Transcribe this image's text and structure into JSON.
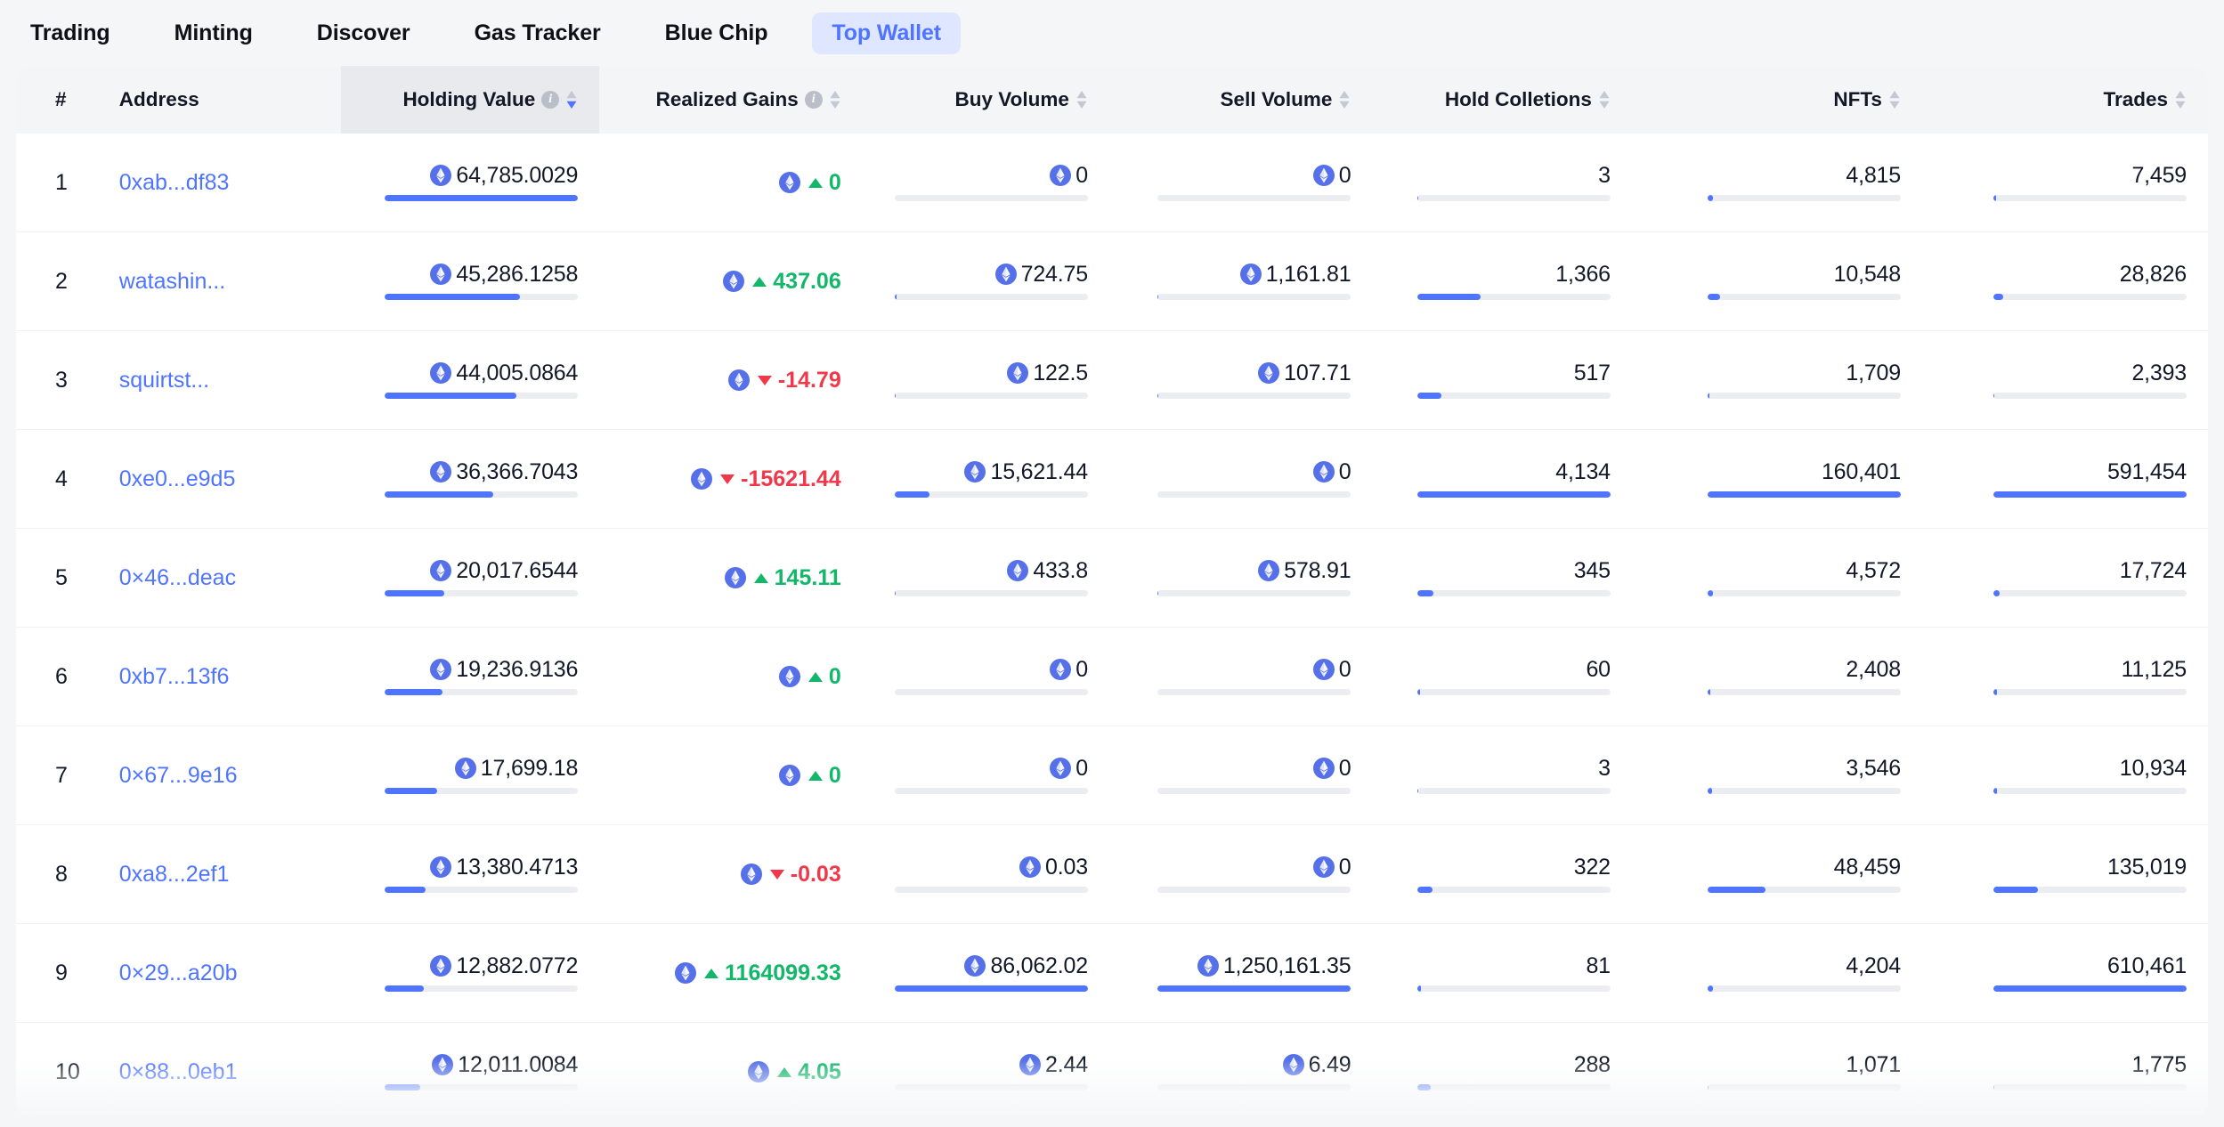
{
  "nav": {
    "items": [
      {
        "label": "Trading",
        "active": false
      },
      {
        "label": "Minting",
        "active": false
      },
      {
        "label": "Discover",
        "active": false
      },
      {
        "label": "Gas Tracker",
        "active": false
      },
      {
        "label": "Blue Chip",
        "active": false
      },
      {
        "label": "Top Wallet",
        "active": true
      }
    ]
  },
  "table": {
    "columns": [
      {
        "key": "rank",
        "label": "#",
        "align": "left",
        "info": false,
        "sort": "none"
      },
      {
        "key": "addr",
        "label": "Address",
        "align": "left",
        "info": false,
        "sort": "none"
      },
      {
        "key": "hold",
        "label": "Holding Value",
        "align": "right",
        "info": true,
        "sort": "desc"
      },
      {
        "key": "gains",
        "label": "Realized Gains",
        "align": "right",
        "info": true,
        "sort": "none"
      },
      {
        "key": "buy",
        "label": "Buy Volume",
        "align": "right",
        "info": false,
        "sort": "none"
      },
      {
        "key": "sell",
        "label": "Sell Volume",
        "align": "right",
        "info": false,
        "sort": "none"
      },
      {
        "key": "coll",
        "label": "Hold Colletions",
        "align": "right",
        "info": false,
        "sort": "none"
      },
      {
        "key": "nfts",
        "label": "NFTs",
        "align": "right",
        "info": false,
        "sort": "none"
      },
      {
        "key": "trades",
        "label": "Trades",
        "align": "right",
        "info": false,
        "sort": "none"
      }
    ],
    "rows": [
      {
        "rank": "1",
        "address": "0xab...df83",
        "holding_value": "64,785.0029",
        "holding_pct": 100,
        "realized_gains": "0",
        "gains_dir": "up",
        "buy_volume": "0",
        "buy_pct": 0,
        "sell_volume": "0",
        "sell_pct": 0,
        "hold_collections": "3",
        "coll_pct": 0.1,
        "nfts": "4,815",
        "nfts_pct": 3,
        "trades": "7,459",
        "trades_pct": 1.3
      },
      {
        "rank": "2",
        "address": "watashin...",
        "holding_value": "45,286.1258",
        "holding_pct": 70,
        "realized_gains": "437.06",
        "gains_dir": "up",
        "buy_volume": "724.75",
        "buy_pct": 0.9,
        "sell_volume": "1,161.81",
        "sell_pct": 0.1,
        "hold_collections": "1,366",
        "coll_pct": 33,
        "nfts": "10,548",
        "nfts_pct": 6.5,
        "trades": "28,826",
        "trades_pct": 4.9
      },
      {
        "rank": "3",
        "address": "squirtst...",
        "holding_value": "44,005.0864",
        "holding_pct": 68,
        "realized_gains": "-14.79",
        "gains_dir": "down",
        "buy_volume": "122.5",
        "buy_pct": 0.2,
        "sell_volume": "107.71",
        "sell_pct": 0.1,
        "hold_collections": "517",
        "coll_pct": 12.5,
        "nfts": "1,709",
        "nfts_pct": 1.1,
        "trades": "2,393",
        "trades_pct": 0.4
      },
      {
        "rank": "4",
        "address": "0xe0...e9d5",
        "holding_value": "36,366.7043",
        "holding_pct": 56,
        "realized_gains": "-15621.44",
        "gains_dir": "down",
        "buy_volume": "15,621.44",
        "buy_pct": 18,
        "sell_volume": "0",
        "sell_pct": 0,
        "hold_collections": "4,134",
        "coll_pct": 100,
        "nfts": "160,401",
        "nfts_pct": 100,
        "trades": "591,454",
        "trades_pct": 100
      },
      {
        "rank": "5",
        "address": "0×46...deac",
        "holding_value": "20,017.6544",
        "holding_pct": 31,
        "realized_gains": "145.11",
        "gains_dir": "up",
        "buy_volume": "433.8",
        "buy_pct": 0.5,
        "sell_volume": "578.91",
        "sell_pct": 0.05,
        "hold_collections": "345",
        "coll_pct": 8.3,
        "nfts": "4,572",
        "nfts_pct": 2.9,
        "trades": "17,724",
        "trades_pct": 3
      },
      {
        "rank": "6",
        "address": "0xb7...13f6",
        "holding_value": "19,236.9136",
        "holding_pct": 30,
        "realized_gains": "0",
        "gains_dir": "up",
        "buy_volume": "0",
        "buy_pct": 0,
        "sell_volume": "0",
        "sell_pct": 0,
        "hold_collections": "60",
        "coll_pct": 1.5,
        "nfts": "2,408",
        "nfts_pct": 1.5,
        "trades": "11,125",
        "trades_pct": 1.9
      },
      {
        "rank": "7",
        "address": "0×67...9e16",
        "holding_value": "17,699.18",
        "holding_pct": 27,
        "realized_gains": "0",
        "gains_dir": "up",
        "buy_volume": "0",
        "buy_pct": 0,
        "sell_volume": "0",
        "sell_pct": 0,
        "hold_collections": "3",
        "coll_pct": 0.1,
        "nfts": "3,546",
        "nfts_pct": 2.2,
        "trades": "10,934",
        "trades_pct": 1.8
      },
      {
        "rank": "8",
        "address": "0xa8...2ef1",
        "holding_value": "13,380.4713",
        "holding_pct": 21,
        "realized_gains": "-0.03",
        "gains_dir": "down",
        "buy_volume": "0.03",
        "buy_pct": 0,
        "sell_volume": "0",
        "sell_pct": 0,
        "hold_collections": "322",
        "coll_pct": 7.8,
        "nfts": "48,459",
        "nfts_pct": 30,
        "trades": "135,019",
        "trades_pct": 23
      },
      {
        "rank": "9",
        "address": "0×29...a20b",
        "holding_value": "12,882.0772",
        "holding_pct": 20,
        "realized_gains": "1164099.33",
        "gains_dir": "up",
        "buy_volume": "86,062.02",
        "buy_pct": 100,
        "sell_volume": "1,250,161.35",
        "sell_pct": 100,
        "hold_collections": "81",
        "coll_pct": 2,
        "nfts": "4,204",
        "nfts_pct": 2.6,
        "trades": "610,461",
        "trades_pct": 100
      },
      {
        "rank": "10",
        "address": "0×88...0eb1",
        "holding_value": "12,011.0084",
        "holding_pct": 18.5,
        "realized_gains": "4.05",
        "gains_dir": "up",
        "buy_volume": "2.44",
        "buy_pct": 0,
        "sell_volume": "6.49",
        "sell_pct": 0,
        "hold_collections": "288",
        "coll_pct": 7,
        "nfts": "1,071",
        "nfts_pct": 0.7,
        "trades": "1,775",
        "trades_pct": 0.3
      }
    ]
  },
  "icons": {
    "eth": "ethereum-icon",
    "info": "info-icon",
    "sort": "sort-arrows-icon",
    "up": "triangle-up-icon",
    "down": "triangle-down-icon"
  },
  "colors": {
    "accent": "#4f74ff",
    "accent_bg": "#dfe6ff",
    "gain": "#12b76a",
    "loss": "#f0384a",
    "bar_track": "#ebedf0",
    "header_bg": "#f4f5f7",
    "header_sorted_bg": "#e8eaee",
    "page_bg": "#f5f6f8",
    "card_bg": "#ffffff"
  }
}
